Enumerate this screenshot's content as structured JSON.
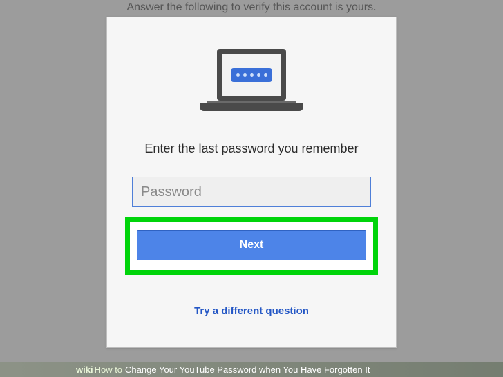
{
  "header": {
    "instruction": "Answer the following to verify this account is yours."
  },
  "card": {
    "prompt": "Enter the last password you remember",
    "password_placeholder": "Password",
    "next_label": "Next",
    "alt_link": "Try a different question"
  },
  "footer": {
    "brand_prefix": "wiki",
    "brand_suffix": "How to ",
    "article": "Change Your YouTube Password when You Have Forgotten It"
  },
  "icons": {
    "laptop": "laptop-password-icon"
  },
  "colors": {
    "highlight": "#00d40a",
    "primary_button": "#4d84e8",
    "link": "#2457c5"
  }
}
